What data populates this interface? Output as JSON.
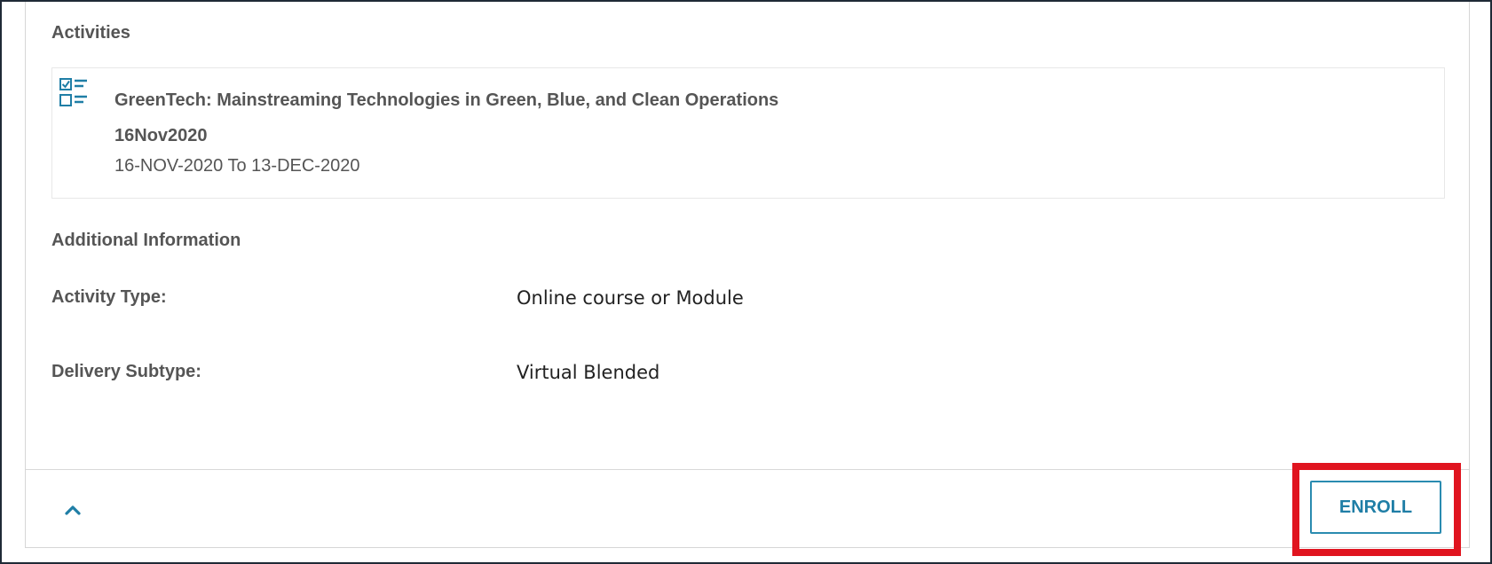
{
  "activities_section": {
    "title": "Activities",
    "items": [
      {
        "icon": "checklist-icon",
        "name": "GreenTech: Mainstreaming Technologies in Green, Blue, and Clean Operations 16Nov2020",
        "dates": "16-NOV-2020  To  13-DEC-2020"
      }
    ]
  },
  "additional_info": {
    "title": "Additional Information",
    "rows": [
      {
        "label": "Activity Type:",
        "value": "Online course or Module"
      },
      {
        "label": "Delivery Subtype:",
        "value": "Virtual Blended"
      }
    ]
  },
  "footer": {
    "collapse_icon": "chevron-up-icon",
    "enroll_label": "ENROLL"
  },
  "colors": {
    "accent": "#1f7ea6",
    "highlight": "#e0141f"
  }
}
